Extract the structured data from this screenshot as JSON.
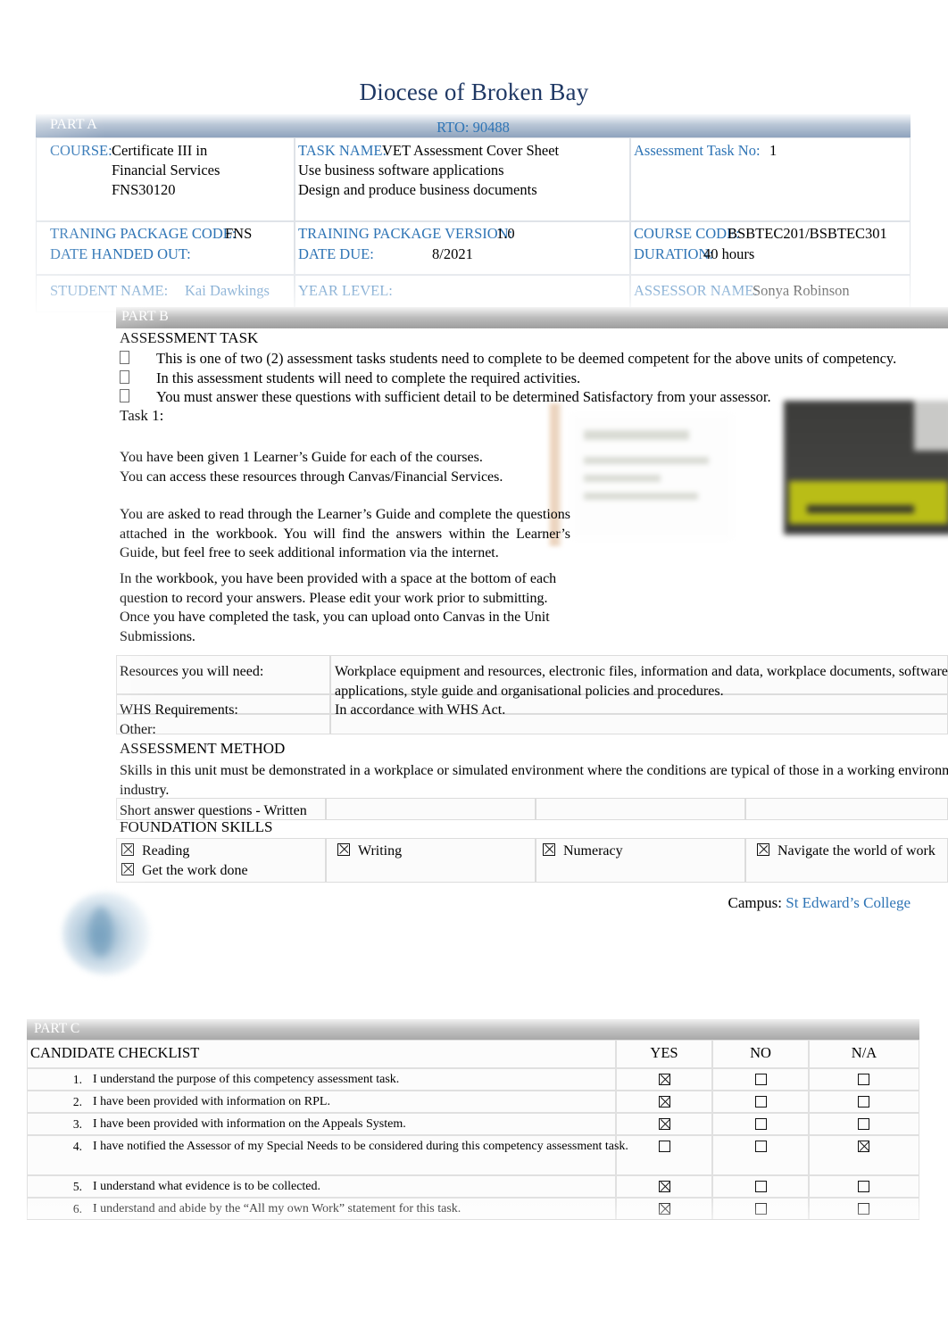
{
  "header": {
    "title": "Diocese of Broken Bay",
    "rto": "RTO: 90488",
    "title_color": "#1f3864",
    "label_color": "#2e74b5"
  },
  "part_a": {
    "band_label": "PART A",
    "course_label": "COURSE:",
    "course_value_line1": "Certificate III in",
    "course_value_line2": "Financial Services",
    "course_value_line3": "FNS30120",
    "task_name_label": "TASK NAME:",
    "task_name_line1": "VET Assessment Cover Sheet",
    "task_name_line2": "Use business software applications",
    "task_name_line3": "Design and produce business documents",
    "assessment_task_no_label": "Assessment Task No:",
    "assessment_task_no_value": "1",
    "training_package_code_label": "TRANING PACKAGE CODE:",
    "training_package_code_value": "FNS",
    "training_package_version_label": "TRAINING PACKAGE VERSION:",
    "training_package_version_value": "1.0",
    "course_code_label": "COURSE CODE:",
    "course_code_value": "BSBTEC201/BSBTEC301",
    "date_handed_out_label": "DATE HANDED OUT:",
    "date_handed_out_value": "",
    "date_due_label": "DATE DUE:",
    "date_due_value": "8/2021",
    "duration_label": "DURATION:",
    "duration_value": "40 hours",
    "student_name_label": "STUDENT NAME:",
    "student_name_value": "Kai Dawkings",
    "year_level_label": "YEAR LEVEL:",
    "year_level_value": "",
    "assessor_name_label": "ASSESSOR NAME:",
    "assessor_name_value": "Sonya Robinson"
  },
  "part_b": {
    "band_label": "PART B",
    "assessment_task_heading": "ASSESSMENT TASK",
    "bullets": [
      "This is one of two (2) assessment tasks students need to complete to be deemed competent for the above units of competency.",
      "In this assessment students will need to complete the required activities.",
      "You must answer these questions with sufficient detail to be determined Satisfactory from your assessor."
    ],
    "task_heading": "Task 1:",
    "para_1_line_1": "You have been given 1 Learner’s Guide for each of the courses.",
    "para_1_line_2": "You can access these resources through Canvas/Financial Services.",
    "para_2": "You are asked to read through the Learner’s Guide and complete the questions attached in the workbook. You will find the answers within the Learner’s Guide, but feel free to seek additional information via the internet.",
    "para_3": "In the workbook, you have been provided with a space at the bottom of each question to record your answers. Please edit your work prior to submitting. Once you have completed the task, you can upload onto Canvas in the Unit Submissions.",
    "resources_label": "Resources you will need:",
    "resources_value": "Workplace equipment and resources, electronic files, information and data, workplace documents, software applications, style guide and organisational policies and procedures.",
    "whs_label": "WHS Requirements:",
    "whs_value": "In accordance with WHS Act.",
    "other_label": "Other:",
    "assessment_method_heading": "ASSESSMENT METHOD",
    "assessment_method_text": "Skills in this unit must be demonstrated in a workplace or simulated environment where the conditions are typical of those in a working environment in this industry.",
    "assessment_method_type": "Short answer questions - Written",
    "foundation_skills_heading": "FOUNDATION SKILLS",
    "foundation_skills": [
      {
        "label": "Reading",
        "checked": true
      },
      {
        "label": "Writing",
        "checked": true
      },
      {
        "label": "Numeracy",
        "checked": true
      },
      {
        "label": "Navigate the world of work",
        "checked": true
      },
      {
        "label": "Get the work done",
        "checked": true
      }
    ]
  },
  "footer": {
    "campus_label": "Campus:",
    "campus_value": "St Edward’s College"
  },
  "part_c": {
    "band_label": "PART C",
    "title": "CANDIDATE CHECKLIST",
    "columns": [
      "YES",
      "NO",
      "N/A"
    ],
    "rows": [
      {
        "num": "1.",
        "text": "I understand the purpose of this competency assessment task.",
        "yes": true,
        "no": false,
        "na": false
      },
      {
        "num": "2.",
        "text": "I have been provided with information on RPL.",
        "yes": true,
        "no": false,
        "na": false
      },
      {
        "num": "3.",
        "text": "I have been provided with information on the Appeals System.",
        "yes": true,
        "no": false,
        "na": false
      },
      {
        "num": "4.",
        "text": "I have notified the Assessor of my Special Needs to be considered during this competency assessment task.",
        "yes": false,
        "no": false,
        "na": true
      },
      {
        "num": "5.",
        "text": "I understand what evidence is to be collected.",
        "yes": true,
        "no": false,
        "na": false
      },
      {
        "num": "6.",
        "text": "I understand and abide by the “All my own Work” statement for this task.",
        "yes": true,
        "no": false,
        "na": false
      }
    ]
  }
}
